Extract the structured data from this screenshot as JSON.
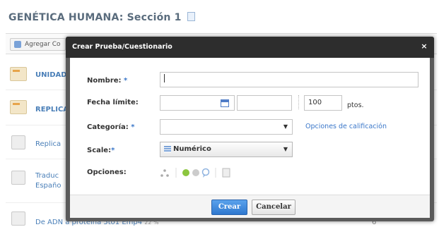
{
  "page": {
    "title": "GENÉTICA HUMANA: Sección 1",
    "toolbar": {
      "add_button_label": "Agregar Co"
    },
    "rows": [
      {
        "label": "UNIDAD",
        "icon": "folder-icon"
      },
      {
        "label": "REPLICA",
        "icon": "folder-icon"
      },
      {
        "label": "Replica",
        "icon": "document-icon"
      },
      {
        "label": "Traduc",
        "label2": "Españo",
        "icon": "document-icon"
      }
    ],
    "bottom_link": "De ADN a proteína 5to1 Emp4",
    "bottom_link_meta": "22 %",
    "bottom_right": "6"
  },
  "dialog": {
    "title": "Crear Prueba/Cuestionario",
    "close_label": "×",
    "fields": {
      "name_label": "Nombre:",
      "name_required": "*",
      "name_value": "",
      "due_label": "Fecha límite:",
      "points_value": "100",
      "points_unit": "ptos.",
      "category_label": "Categoría:",
      "category_required": "*",
      "grading_options_link": "Opciones de calificación",
      "scale_label": "Scale:",
      "scale_required": "*",
      "scale_value": "Numérico",
      "options_label": "Opciones:"
    },
    "buttons": {
      "create": "Crear",
      "cancel": "Cancelar"
    }
  },
  "colors": {
    "accent": "#3a77c9",
    "header": "#2d2d2d",
    "option_green": "#8cc63f"
  }
}
